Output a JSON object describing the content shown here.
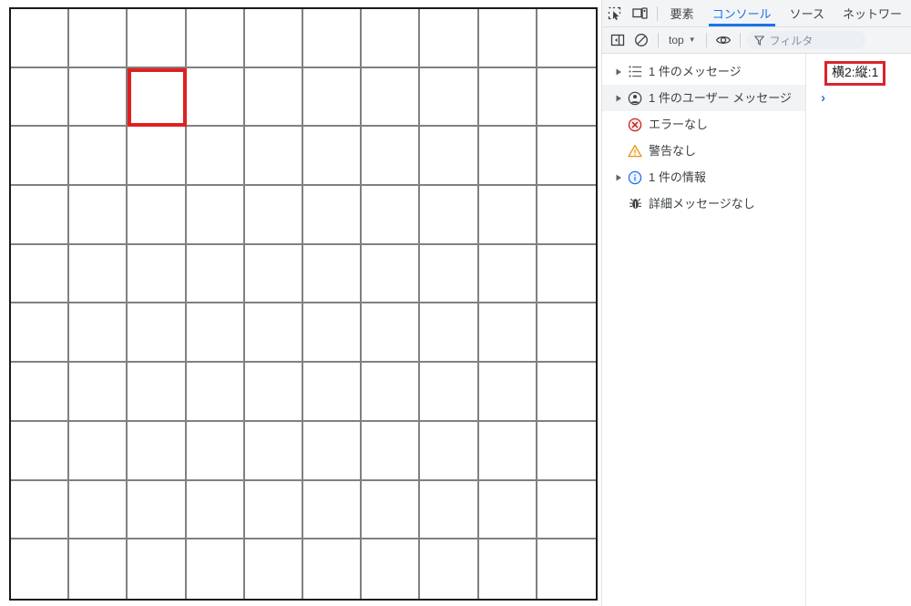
{
  "grid": {
    "columns": 10,
    "rows": 10,
    "border_color": "#1a1a1a",
    "line_color": "#808080",
    "highlight": {
      "col": 2,
      "row": 1,
      "color": "#e02020",
      "label": "selected-cell"
    }
  },
  "devtools": {
    "tabbar": {
      "inspect_icon": "inspect-element-icon",
      "device_icon": "device-toolbar-icon",
      "tabs": [
        {
          "label": "要素",
          "active": false
        },
        {
          "label": "コンソール",
          "active": true
        },
        {
          "label": "ソース",
          "active": false
        },
        {
          "label": "ネットワー",
          "active": false
        }
      ]
    },
    "toolbar": {
      "sidebar_toggle_icon": "sidebar-toggle-icon",
      "clear_console_icon": "clear-console-icon",
      "context_value": "top",
      "context_caret": "▼",
      "eye_icon": "live-expression-eye-icon",
      "filter_icon": "filter-funnel-icon",
      "filter_placeholder": "フィルタ",
      "filter_value": ""
    },
    "sidebar": {
      "items": [
        {
          "label": "1 件のメッセージ",
          "icon": "message-list-icon",
          "expandable": true,
          "selected": false
        },
        {
          "label": "1 件のユーザー メッセージ",
          "icon": "user-message-icon",
          "expandable": true,
          "selected": true
        },
        {
          "label": "エラーなし",
          "icon": "error-icon",
          "expandable": false,
          "selected": false
        },
        {
          "label": "警告なし",
          "icon": "warning-icon",
          "expandable": false,
          "selected": false
        },
        {
          "label": "1 件の情報",
          "icon": "info-icon",
          "expandable": true,
          "selected": false
        },
        {
          "label": "詳細メッセージなし",
          "icon": "verbose-bug-icon",
          "expandable": false,
          "selected": false
        }
      ]
    },
    "output": {
      "message": "横2:縦:1",
      "message_box_color": "#d8252a",
      "prompt_caret": "›"
    }
  }
}
